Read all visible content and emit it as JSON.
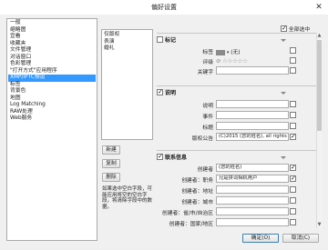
{
  "window": {
    "title": "偏好设置",
    "close_glyph": "✕"
  },
  "categories": [
    {
      "label": "一般",
      "selected": false
    },
    {
      "label": "缩略图",
      "selected": false
    },
    {
      "label": "宜看",
      "selected": false
    },
    {
      "label": "收藏夹",
      "selected": false
    },
    {
      "label": "文件管理",
      "selected": false
    },
    {
      "label": "对话窗口",
      "selected": false
    },
    {
      "label": "色彩管理",
      "selected": false
    },
    {
      "label": "\"打开方式\"应用程序",
      "selected": false
    },
    {
      "label": "XMP/IPTC预设",
      "selected": true
    },
    {
      "label": "标签",
      "selected": false
    },
    {
      "label": "背景色",
      "selected": false
    },
    {
      "label": "地图",
      "selected": false
    },
    {
      "label": "Log Matching",
      "selected": false
    },
    {
      "label": "RAW处理",
      "selected": false
    },
    {
      "label": "Web服务",
      "selected": false
    }
  ],
  "presets": [
    "仅版权",
    "表演",
    "婚礼"
  ],
  "preset_buttons": {
    "new": "新建",
    "copy": "复制",
    "delete": "删除"
  },
  "hint": "如果选中空白字段，可能应用将空的空白字段，将清除字段中的数据。",
  "select_all": {
    "label": "全部选中",
    "checked": true
  },
  "sections": {
    "tags": {
      "title": "标记",
      "checked": false,
      "rows": {
        "label": {
          "label": "标签",
          "value": "(无)",
          "swatch_color": "#8a8a8a",
          "checked": false
        },
        "rating": {
          "label": "评级",
          "value": "☆☆☆☆☆",
          "reject_glyph": "⊘",
          "checked": false
        },
        "keywords": {
          "label": "关键字",
          "value": "",
          "checked": false
        }
      }
    },
    "description": {
      "title": "说明",
      "checked": true,
      "rows": {
        "caption": {
          "label": "说明",
          "value": "",
          "checked": false
        },
        "event": {
          "label": "事件",
          "value": "",
          "checked": false
        },
        "headline": {
          "label": "标题",
          "value": "",
          "checked": false
        },
        "copyright": {
          "label": "版权公告",
          "value": "(C)2015 (您的姓名), all rights reser",
          "checked": true
        }
      }
    },
    "contact": {
      "title": "联系信息",
      "checked": true,
      "rows": {
        "creator": {
          "label": "创建者",
          "value": "(您的姓名)",
          "checked": true
        },
        "job_title": {
          "label": "创建者：职务",
          "value": "兄是拼词相机用户",
          "checked": true
        },
        "address": {
          "label": "创建者：地址",
          "value": "",
          "checked": false
        },
        "city": {
          "label": "创建者：城市",
          "value": "",
          "checked": false
        },
        "state": {
          "label": "创建者：省/市/自治区",
          "value": "",
          "checked": false
        },
        "country": {
          "label": "创建者：国家/地区",
          "value": "",
          "checked": false
        }
      }
    }
  },
  "footer": {
    "ok": "确定(O)",
    "cancel": "取消(C)"
  }
}
